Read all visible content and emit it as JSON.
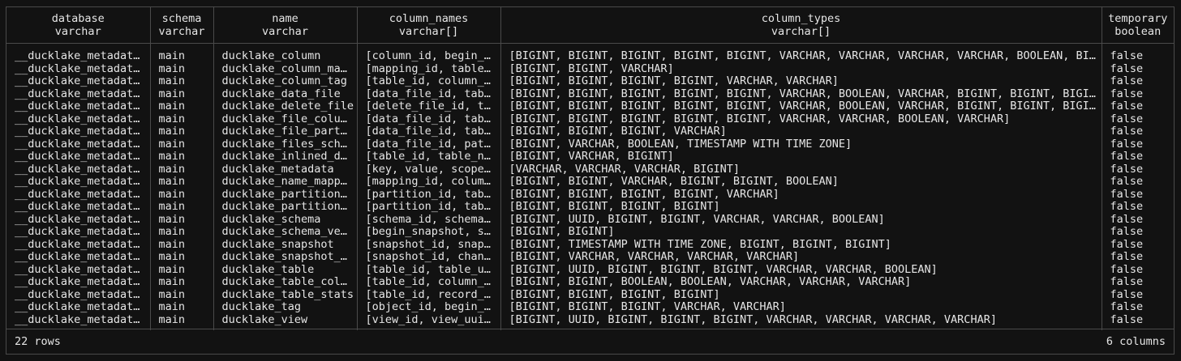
{
  "columns": [
    {
      "name": "database",
      "type": "varchar"
    },
    {
      "name": "schema",
      "type": "varchar"
    },
    {
      "name": "name",
      "type": "varchar"
    },
    {
      "name": "column_names",
      "type": "varchar[]"
    },
    {
      "name": "column_types",
      "type": "varchar[]"
    },
    {
      "name": "temporary",
      "type": "boolean"
    }
  ],
  "rows": [
    [
      "__ducklake_metadat…",
      "main",
      "ducklake_column",
      "[column_id, begin_…",
      "[BIGINT, BIGINT, BIGINT, BIGINT, BIGINT, VARCHAR, VARCHAR, VARCHAR, VARCHAR, BOOLEAN, BIGINT]",
      "false"
    ],
    [
      "__ducklake_metadat…",
      "main",
      "ducklake_column_ma…",
      "[mapping_id, table…",
      "[BIGINT, BIGINT, VARCHAR]",
      "false"
    ],
    [
      "__ducklake_metadat…",
      "main",
      "ducklake_column_tag",
      "[table_id, column_…",
      "[BIGINT, BIGINT, BIGINT, BIGINT, VARCHAR, VARCHAR]",
      "false"
    ],
    [
      "__ducklake_metadat…",
      "main",
      "ducklake_data_file",
      "[data_file_id, tab…",
      "[BIGINT, BIGINT, BIGINT, BIGINT, BIGINT, VARCHAR, BOOLEAN, VARCHAR, BIGINT, BIGINT, BIGINT,…",
      "false"
    ],
    [
      "__ducklake_metadat…",
      "main",
      "ducklake_delete_file",
      "[delete_file_id, t…",
      "[BIGINT, BIGINT, BIGINT, BIGINT, BIGINT, VARCHAR, BOOLEAN, VARCHAR, BIGINT, BIGINT, BIGINT,…",
      "false"
    ],
    [
      "__ducklake_metadat…",
      "main",
      "ducklake_file_colu…",
      "[data_file_id, tab…",
      "[BIGINT, BIGINT, BIGINT, BIGINT, BIGINT, VARCHAR, VARCHAR, BOOLEAN, VARCHAR]",
      "false"
    ],
    [
      "__ducklake_metadat…",
      "main",
      "ducklake_file_part…",
      "[data_file_id, tab…",
      "[BIGINT, BIGINT, BIGINT, VARCHAR]",
      "false"
    ],
    [
      "__ducklake_metadat…",
      "main",
      "ducklake_files_sch…",
      "[data_file_id, pat…",
      "[BIGINT, VARCHAR, BOOLEAN, TIMESTAMP WITH TIME ZONE]",
      "false"
    ],
    [
      "__ducklake_metadat…",
      "main",
      "ducklake_inlined_d…",
      "[table_id, table_n…",
      "[BIGINT, VARCHAR, BIGINT]",
      "false"
    ],
    [
      "__ducklake_metadat…",
      "main",
      "ducklake_metadata",
      "[key, value, scope…",
      "[VARCHAR, VARCHAR, VARCHAR, BIGINT]",
      "false"
    ],
    [
      "__ducklake_metadat…",
      "main",
      "ducklake_name_mapp…",
      "[mapping_id, colum…",
      "[BIGINT, BIGINT, VARCHAR, BIGINT, BIGINT, BOOLEAN]",
      "false"
    ],
    [
      "__ducklake_metadat…",
      "main",
      "ducklake_partition…",
      "[partition_id, tab…",
      "[BIGINT, BIGINT, BIGINT, BIGINT, VARCHAR]",
      "false"
    ],
    [
      "__ducklake_metadat…",
      "main",
      "ducklake_partition…",
      "[partition_id, tab…",
      "[BIGINT, BIGINT, BIGINT, BIGINT]",
      "false"
    ],
    [
      "__ducklake_metadat…",
      "main",
      "ducklake_schema",
      "[schema_id, schema…",
      "[BIGINT, UUID, BIGINT, BIGINT, VARCHAR, VARCHAR, BOOLEAN]",
      "false"
    ],
    [
      "__ducklake_metadat…",
      "main",
      "ducklake_schema_ve…",
      "[begin_snapshot, s…",
      "[BIGINT, BIGINT]",
      "false"
    ],
    [
      "__ducklake_metadat…",
      "main",
      "ducklake_snapshot",
      "[snapshot_id, snap…",
      "[BIGINT, TIMESTAMP WITH TIME ZONE, BIGINT, BIGINT, BIGINT]",
      "false"
    ],
    [
      "__ducklake_metadat…",
      "main",
      "ducklake_snapshot_…",
      "[snapshot_id, chan…",
      "[BIGINT, VARCHAR, VARCHAR, VARCHAR, VARCHAR]",
      "false"
    ],
    [
      "__ducklake_metadat…",
      "main",
      "ducklake_table",
      "[table_id, table_u…",
      "[BIGINT, UUID, BIGINT, BIGINT, BIGINT, VARCHAR, VARCHAR, BOOLEAN]",
      "false"
    ],
    [
      "__ducklake_metadat…",
      "main",
      "ducklake_table_col…",
      "[table_id, column_…",
      "[BIGINT, BIGINT, BOOLEAN, BOOLEAN, VARCHAR, VARCHAR, VARCHAR]",
      "false"
    ],
    [
      "__ducklake_metadat…",
      "main",
      "ducklake_table_stats",
      "[table_id, record_…",
      "[BIGINT, BIGINT, BIGINT, BIGINT]",
      "false"
    ],
    [
      "__ducklake_metadat…",
      "main",
      "ducklake_tag",
      "[object_id, begin_…",
      "[BIGINT, BIGINT, BIGINT, VARCHAR, VARCHAR]",
      "false"
    ],
    [
      "__ducklake_metadat…",
      "main",
      "ducklake_view",
      "[view_id, view_uui…",
      "[BIGINT, UUID, BIGINT, BIGINT, BIGINT, VARCHAR, VARCHAR, VARCHAR, VARCHAR]",
      "false"
    ]
  ],
  "footer": {
    "row_count": "22 rows",
    "column_count": "6 columns"
  }
}
